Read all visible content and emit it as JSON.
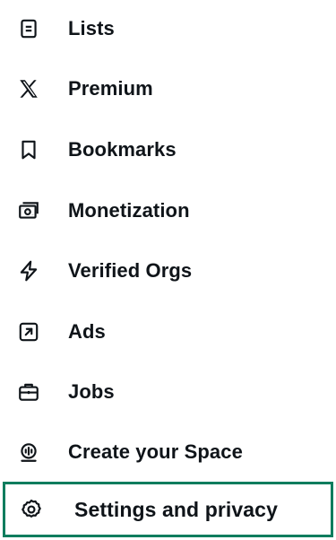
{
  "menu": {
    "items": [
      {
        "label": "Lists",
        "icon": "list-icon"
      },
      {
        "label": "Premium",
        "icon": "x-logo-icon"
      },
      {
        "label": "Bookmarks",
        "icon": "bookmark-icon"
      },
      {
        "label": "Monetization",
        "icon": "money-icon"
      },
      {
        "label": "Verified Orgs",
        "icon": "lightning-icon"
      },
      {
        "label": "Ads",
        "icon": "external-arrow-icon"
      },
      {
        "label": "Jobs",
        "icon": "briefcase-icon"
      },
      {
        "label": "Create your Space",
        "icon": "space-mic-icon"
      },
      {
        "label": "Settings and privacy",
        "icon": "gear-icon"
      }
    ],
    "highlighted_index": 8,
    "highlight_color": "#0f7d5e"
  }
}
